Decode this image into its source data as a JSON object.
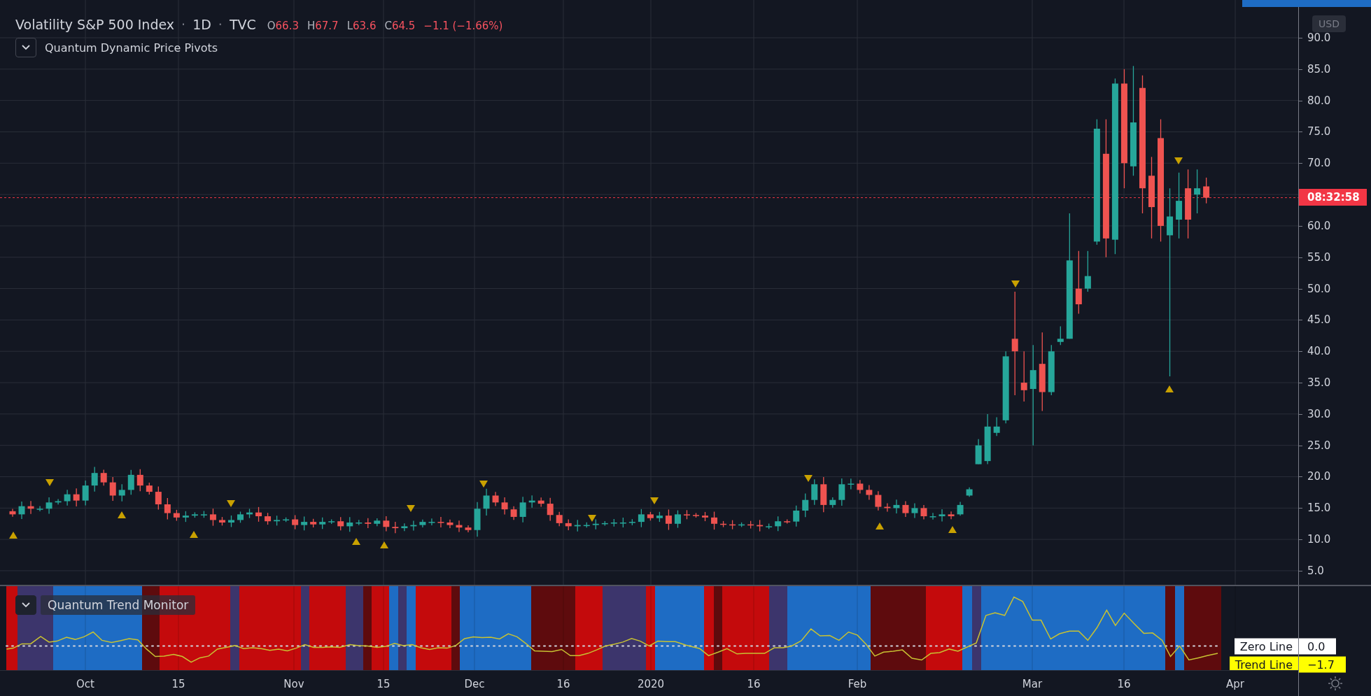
{
  "symbol": {
    "title": "Volatility S&P 500 Index",
    "interval": "1D",
    "exchange": "TVC",
    "separators": [
      "·",
      "·"
    ],
    "ohlc": [
      {
        "label": "O",
        "value": "66.3"
      },
      {
        "label": "H",
        "value": "67.7"
      },
      {
        "label": "L",
        "value": "63.6"
      },
      {
        "label": "C",
        "value": "64.5"
      }
    ],
    "change": "−1.1 (−1.66%)"
  },
  "price_indicator": {
    "name": "Quantum Dynamic Price Pivots"
  },
  "price_axis": {
    "currency": "USD",
    "ticks": [
      "90.0",
      "85.0",
      "80.0",
      "75.0",
      "70.0",
      "60.0",
      "55.0",
      "50.0",
      "45.0",
      "40.0",
      "35.0",
      "30.0",
      "25.0",
      "20.0",
      "15.0",
      "10.0",
      "5.0"
    ],
    "countdown": "08:32:58"
  },
  "trend_monitor": {
    "name": "Quantum Trend Monitor",
    "lines": [
      {
        "name": "Zero Line",
        "value": "0.0",
        "color": "#ffffff"
      },
      {
        "name": "Trend Line",
        "value": "−1.7",
        "color": "#ffff00"
      }
    ]
  },
  "time_axis": {
    "labels": [
      "Oct",
      "15",
      "Nov",
      "15",
      "Dec",
      "16",
      "2020",
      "16",
      "Feb",
      "Mar",
      "16",
      "Apr"
    ]
  }
}
